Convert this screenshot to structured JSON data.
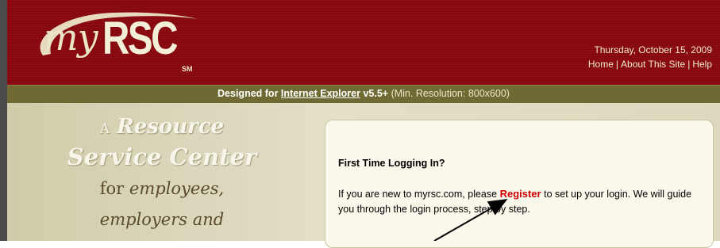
{
  "header": {
    "logo": {
      "my": "my",
      "rsc": "RSC",
      "sm": "SM"
    },
    "date": "Thursday, October 15, 2009",
    "links": [
      {
        "label": "Home"
      },
      {
        "label": "About This Site"
      },
      {
        "label": "Help"
      }
    ]
  },
  "strip": {
    "prefix": "Designed for",
    "browser": "Internet Explorer",
    "version": "v5.5+",
    "resolution": "(Min. Resolution: 800x600)"
  },
  "tagline": {
    "a": "A",
    "line1": "Resource",
    "line2": "Service Center",
    "line3_for": "for",
    "line3_em": "employees,",
    "line4": "employers and"
  },
  "panel": {
    "title": "First Time Logging In?",
    "body_before": "If you are new to myrsc.com, please",
    "register_label": "Register",
    "body_after": "to set up your login. We will guide you through the login process, step by step."
  },
  "colors": {
    "header": "#8e0b12",
    "strip": "#6f6a34",
    "register": "#cc0000"
  }
}
